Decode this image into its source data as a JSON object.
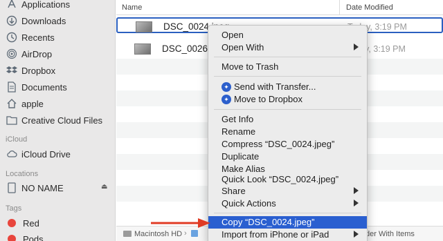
{
  "sidebar": {
    "favorites": [
      {
        "label": "Applications",
        "icon": "applications-icon"
      },
      {
        "label": "Downloads",
        "icon": "downloads-icon"
      },
      {
        "label": "Recents",
        "icon": "recents-icon"
      },
      {
        "label": "AirDrop",
        "icon": "airdrop-icon"
      },
      {
        "label": "Dropbox",
        "icon": "dropbox-icon"
      },
      {
        "label": "Documents",
        "icon": "documents-icon"
      },
      {
        "label": "apple",
        "icon": "home-icon"
      },
      {
        "label": "Creative Cloud Files",
        "icon": "folder-icon"
      }
    ],
    "icloud_heading": "iCloud",
    "icloud_drive": "iCloud Drive",
    "locations_heading": "Locations",
    "no_name": "NO NAME",
    "eject_glyph": "⏏",
    "tags_heading": "Tags",
    "tags": [
      {
        "label": "Red",
        "color": "#e8453c"
      },
      {
        "label": "Pods",
        "color": "#e8453c"
      }
    ]
  },
  "columns": {
    "name": "Name",
    "date": "Date Modified"
  },
  "files": [
    {
      "name": "DSC_0024.jpeg",
      "date": "Today, 3:19 PM",
      "selected": true
    },
    {
      "name": "DSC_0026.jpeg",
      "date": "Today, 3:19 PM",
      "selected": false
    }
  ],
  "pathbar": {
    "drive": "Macintosh HD",
    "sep": "›",
    "tail": "der With Items"
  },
  "menu": {
    "open": "Open",
    "open_with": "Open With",
    "move_to_trash": "Move to Trash",
    "send_with_transfer": "Send with Transfer...",
    "move_to_dropbox": "Move to Dropbox",
    "get_info": "Get Info",
    "rename": "Rename",
    "compress": "Compress “DSC_0024.jpeg”",
    "duplicate": "Duplicate",
    "make_alias": "Make Alias",
    "quick_look": "Quick Look “DSC_0024.jpeg”",
    "share": "Share",
    "quick_actions": "Quick Actions",
    "copy": "Copy “DSC_0024.jpeg”",
    "import_from_iphone": "Import from iPhone or iPad"
  },
  "colors": {
    "accent": "#2a5fd0",
    "annotation_arrow": "#e03b24"
  }
}
